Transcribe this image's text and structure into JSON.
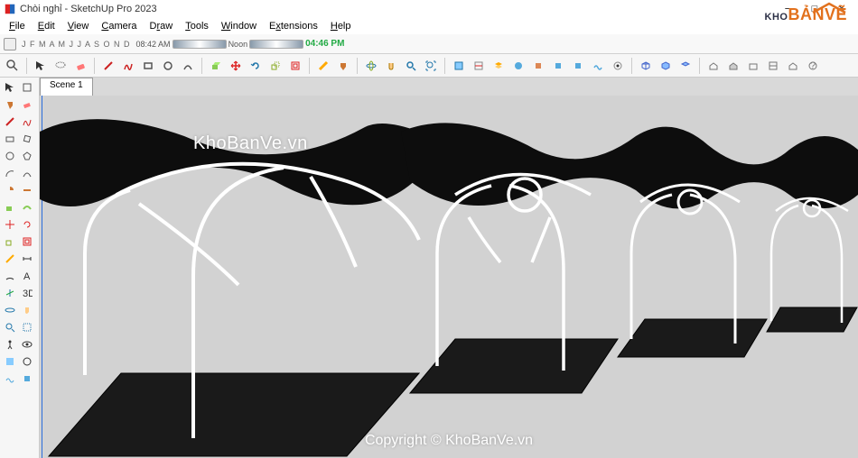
{
  "window": {
    "title": "Chòi nghỉ - SketchUp Pro 2023",
    "controls": {
      "min": "−",
      "max": "□",
      "close": "×"
    }
  },
  "menu": {
    "file": "File",
    "edit": "Edit",
    "view": "View",
    "camera": "Camera",
    "draw": "Draw",
    "tools": "Tools",
    "window": "Window",
    "extensions": "Extensions",
    "help": "Help"
  },
  "time": {
    "months": "J F M A M J J A S O N D",
    "t1_label": "08:42 AM",
    "noon": "Noon",
    "t2_label": "04:46 PM"
  },
  "scene": {
    "tab1": "Scene 1"
  },
  "watermark": {
    "site": "KhoBanVe.vn",
    "copyright": "Copyright © KhoBanVe.vn"
  },
  "brand": {
    "a": "KHO",
    "b": "BẢNVẼ"
  },
  "toolbar_names": {
    "search": "search",
    "select": "select",
    "eraser": "eraser",
    "line": "line",
    "arc": "arc",
    "rect": "rectangle",
    "circle": "circle",
    "pushpull": "push-pull",
    "move": "move",
    "rotate": "rotate",
    "scale": "scale",
    "offset": "offset",
    "tape": "tape-measure",
    "text": "text",
    "paint": "paint-bucket",
    "orbit": "orbit",
    "pan": "pan",
    "zoom": "zoom",
    "zoome": "zoom-extents"
  }
}
